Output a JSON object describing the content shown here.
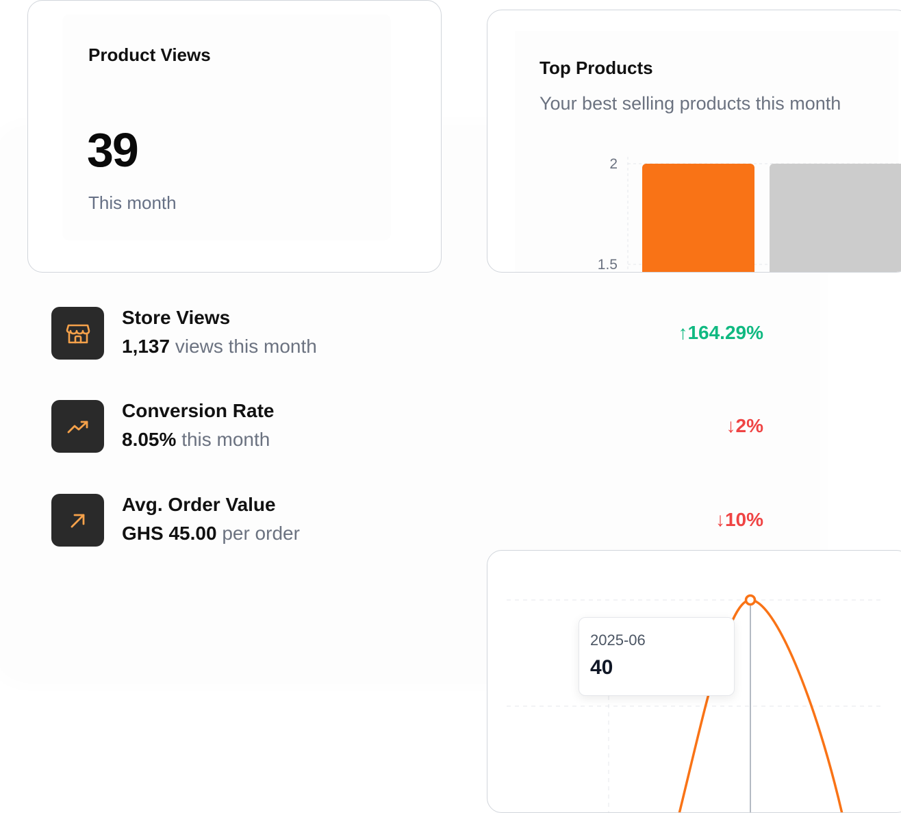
{
  "product_views": {
    "title": "Product Views",
    "value": "39",
    "subtitle": "This month"
  },
  "top_products": {
    "title": "Top Products",
    "subtitle": "Your best selling products this month"
  },
  "metrics": [
    {
      "title": "Store Views",
      "value": "1,137",
      "suffix": "views this month",
      "delta": "164.29%",
      "direction": "up",
      "arrow": "↑",
      "icon": "store-icon"
    },
    {
      "title": "Conversion Rate",
      "value": "8.05%",
      "suffix": "this month",
      "delta": "2%",
      "direction": "down",
      "arrow": "↓",
      "icon": "trending-up-icon"
    },
    {
      "title": "Avg. Order Value",
      "value": "GHS 45.00",
      "suffix": "per order",
      "delta": "10%",
      "direction": "down",
      "arrow": "↓",
      "icon": "arrow-up-right-icon"
    }
  ],
  "line_tooltip": {
    "label": "2025-06",
    "value": "40"
  },
  "colors": {
    "accent": "#f97316",
    "bar_secondary": "#cccccc",
    "positive": "#10b981",
    "negative": "#ef4444",
    "icon_bg": "#2a2a2a"
  },
  "chart_data": [
    {
      "type": "bar",
      "title": "Top Products",
      "subtitle": "Your best selling products this month",
      "values": [
        2,
        2
      ],
      "colors": [
        "#f97316",
        "#cccccc"
      ],
      "y_ticks": [
        "2",
        "1.5"
      ],
      "ylim": [
        1.5,
        2
      ],
      "grid": true
    },
    {
      "type": "line",
      "x": [
        "2025-06"
      ],
      "values": [
        40
      ],
      "highlight": {
        "x": "2025-06",
        "y": 40
      },
      "grid": true
    }
  ]
}
